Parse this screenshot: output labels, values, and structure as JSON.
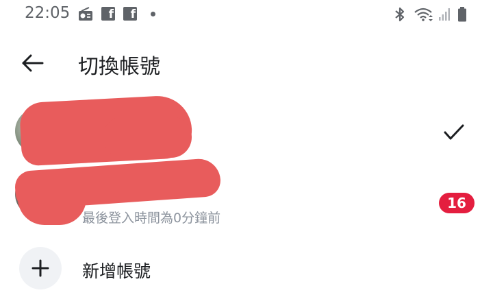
{
  "status_bar": {
    "time": "22:05",
    "left_icons": [
      "radio-icon",
      "facebook-icon",
      "facebook-icon",
      "dot-icon"
    ],
    "right_icons": [
      "bluetooth-icon",
      "wifi-icon",
      "signal-icon",
      "battery-icon"
    ],
    "facebook_glyph": "f"
  },
  "header": {
    "title": "切換帳號",
    "back_icon": "arrow-left-icon"
  },
  "accounts": [
    {
      "name": "",
      "subtitle": "",
      "active": true,
      "trailing_icon": "checkmark-icon"
    },
    {
      "name": "",
      "subtitle": "最後登入時間為0分鐘前",
      "active": false,
      "badge": "16"
    }
  ],
  "add_account": {
    "label": "新增帳號",
    "icon": "plus-icon"
  },
  "colors": {
    "badge": "#e41e3f",
    "redaction": "#e85c5c",
    "secondary_text": "#8d949e",
    "add_circle_bg": "#f0f2f5"
  }
}
